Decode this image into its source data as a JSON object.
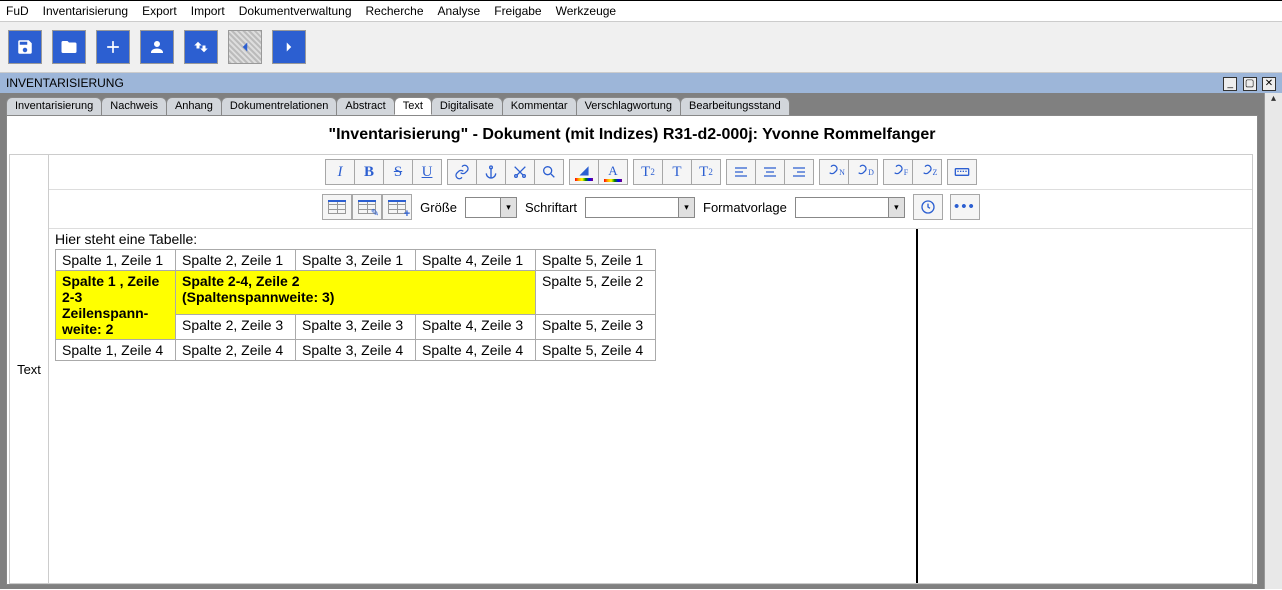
{
  "menubar": [
    "FuD",
    "Inventarisierung",
    "Export",
    "Import",
    "Dokumentverwaltung",
    "Recherche",
    "Analyse",
    "Freigabe",
    "Werkzeuge"
  ],
  "panel": {
    "title": "INVENTARISIERUNG"
  },
  "tabs": [
    "Inventarisierung",
    "Nachweis",
    "Anhang",
    "Dokumentrelationen",
    "Abstract",
    "Text",
    "Digitalisate",
    "Kommentar",
    "Verschlagwortung",
    "Bearbeitungsstand"
  ],
  "activeTab": "Text",
  "doc": {
    "title": "\"Inventarisierung\" - Dokument (mit Indizes) R31-d2-000j: Yvonne Rommelfanger"
  },
  "labels": {
    "sideText": "Text",
    "size": "Größe",
    "font": "Schriftart",
    "style": "Formatvorlage"
  },
  "content": {
    "caption": "Hier steht eine Tabelle:",
    "rows": {
      "r1": [
        "Spalte 1, Zeile 1",
        "Spalte 2, Zeile 1",
        "Spalte 3, Zeile 1",
        "Spalte 4,   Zeile 1",
        "Spalte 5, Zeile 1"
      ],
      "r2_col1": "Spalte 1 , Zeile 2-3\nZeilenspann-weite: 2",
      "r2_col234": "Spalte 2-4, Zeile 2\n(Spaltenspannweite: 3)",
      "r2_col5": "Spalte 5, Zeile 2",
      "r3": [
        "Spalte 2, Zeile 3",
        "Spalte 3, Zeile 3",
        "Spalte 4,  Zeile 3",
        "Spalte 5, Zeile 3"
      ],
      "r4": [
        "Spalte 1, Zeile 4",
        "Spalte 2, Zeile 4",
        "Spalte 3, Zeile 4",
        "Spalte 4,  Zeile 4",
        "Spalte 5, Zeile 4"
      ]
    }
  }
}
